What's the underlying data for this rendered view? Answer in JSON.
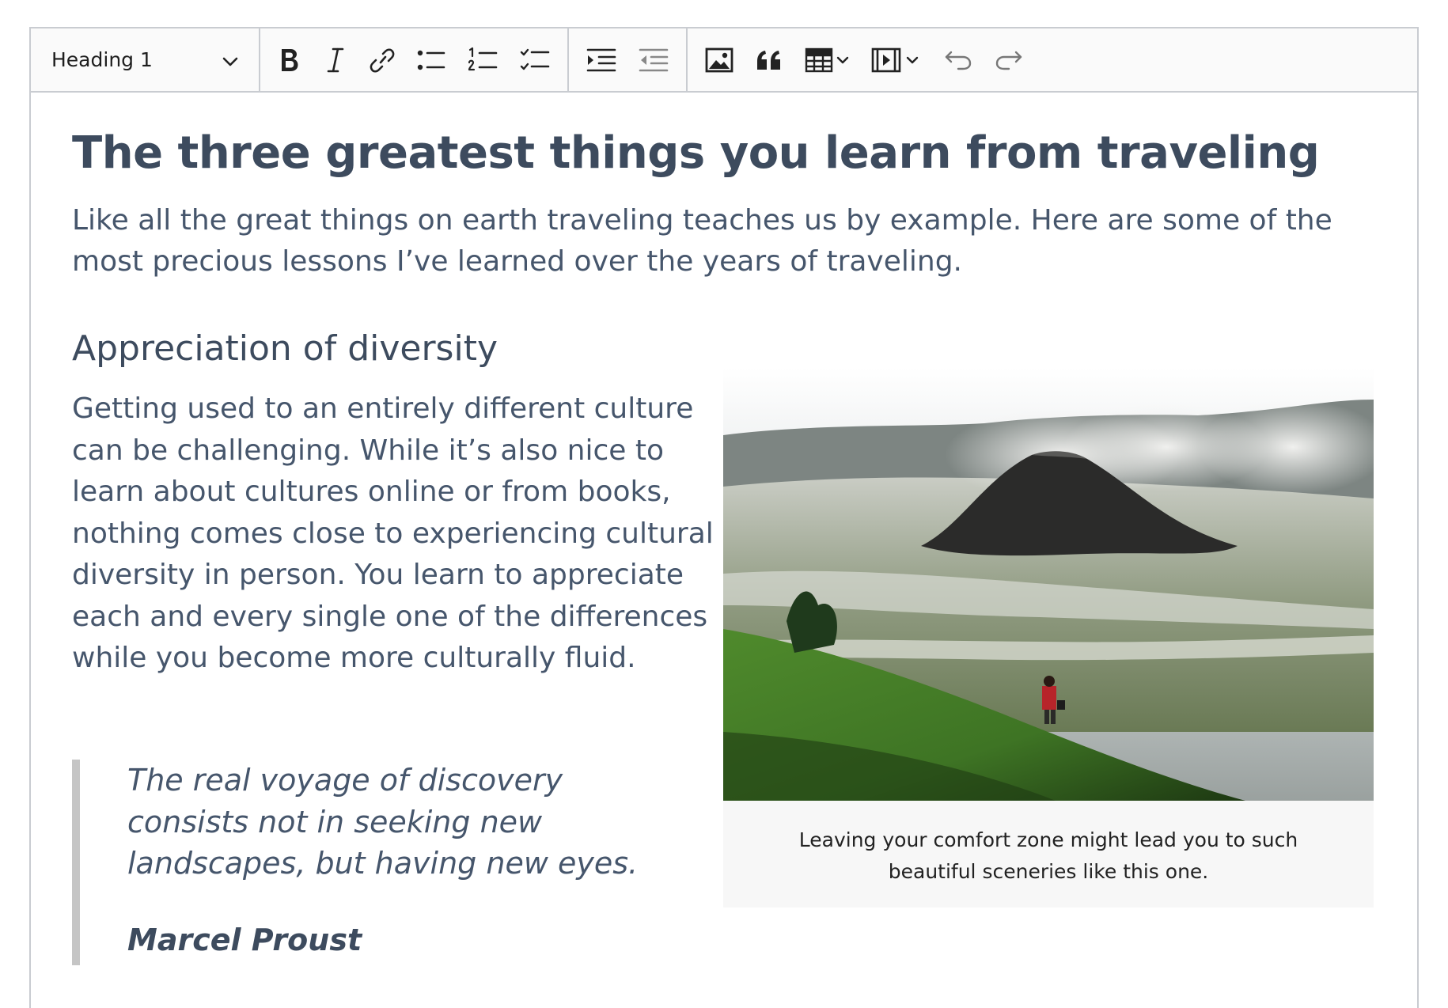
{
  "toolbar": {
    "heading_select": "Heading 1",
    "buttons": [
      "Bold",
      "Italic",
      "Link",
      "Bulleted List",
      "Numbered List",
      "To-do List",
      "Increase indent",
      "Decrease indent",
      "Insert image",
      "Block quote",
      "Insert table",
      "Insert media",
      "Undo",
      "Redo"
    ]
  },
  "document": {
    "title": "The three greatest things you learn from traveling",
    "lead": "Like all the great things on earth traveling teaches us by example. Here are some of the most precious lessons I’ve learned over the years of traveling.",
    "section_heading": "Appreciation of diversity",
    "section_body": "Getting used to an entirely different culture can be challenging. While it’s also nice to learn about cultures online or from books, nothing comes close to experiencing cultural diversity in person. You learn to appreciate each and every single one of the differences while you become more culturally fluid.",
    "quote": "The real voyage of discovery consists not in seeking new landscapes, but having new eyes.",
    "quote_author": "Marcel Proust",
    "figure_caption": "Leaving your comfort zone might lead you to such beautiful sceneries like this one."
  },
  "icons": {
    "dropdown": "chevron-down-icon",
    "bold": "bold-icon",
    "italic": "italic-icon",
    "link": "link-icon",
    "bulleted_list": "bulleted-list-icon",
    "numbered_list": "numbered-list-icon",
    "todo_list": "todo-list-icon",
    "indent": "indent-icon",
    "outdent": "outdent-icon",
    "image": "image-icon",
    "quote": "quote-icon",
    "table": "table-icon",
    "media": "media-icon",
    "undo": "undo-icon",
    "redo": "redo-icon"
  },
  "colors": {
    "text": "#46566c",
    "heading": "#3d4b5e",
    "toolbar_bg": "#fafafa",
    "border": "#c9ccd1",
    "caption_bg": "#f7f7f7",
    "quote_border": "#c5c5c5"
  }
}
